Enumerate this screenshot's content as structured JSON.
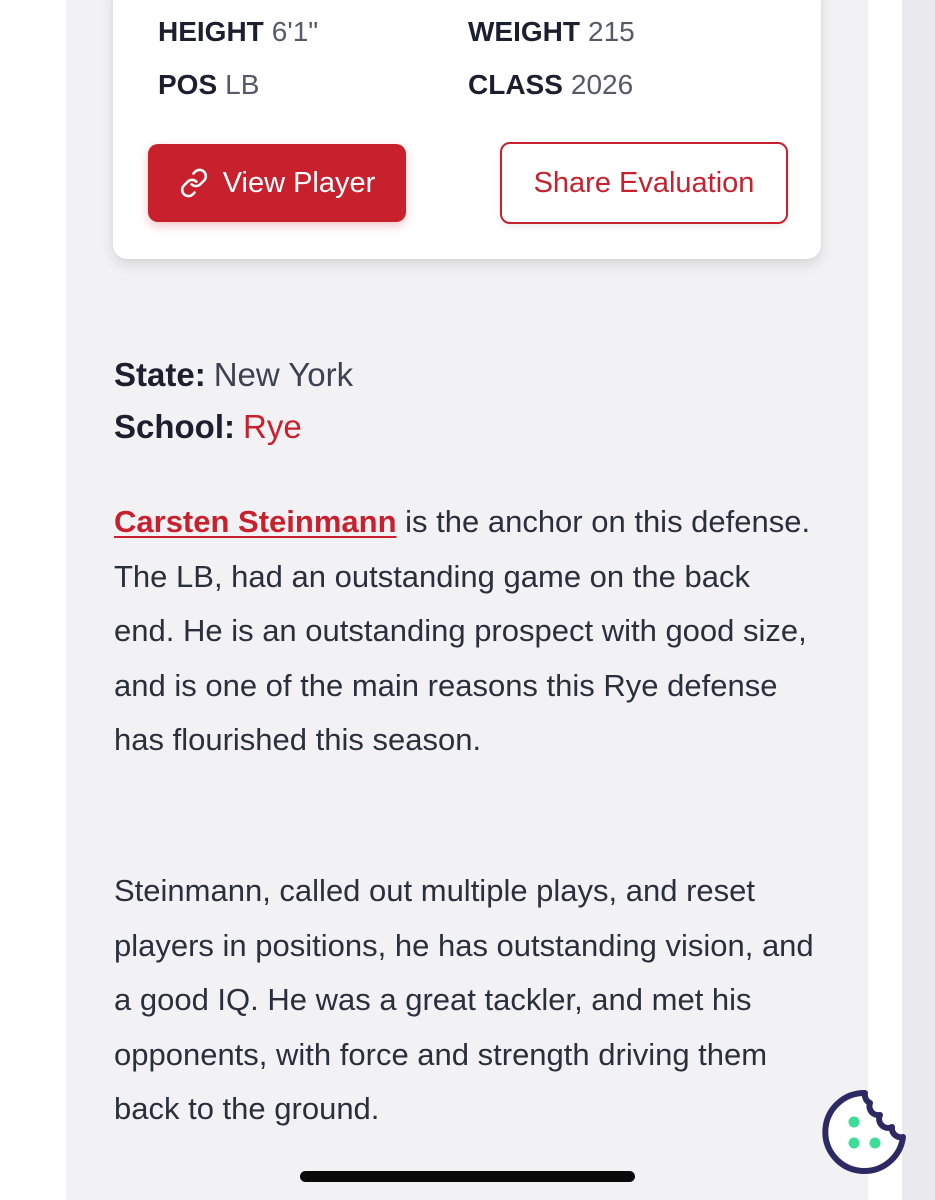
{
  "player_card": {
    "height_label": "HEIGHT",
    "height_value": "6'1\"",
    "weight_label": "WEIGHT",
    "weight_value": "215",
    "pos_label": "POS",
    "pos_value": "LB",
    "class_label": "CLASS",
    "class_value": "2026",
    "view_player_label": "View Player",
    "view_player_icon": "link-icon",
    "share_label": "Share Evaluation"
  },
  "meta": {
    "state_label": "State:",
    "state_value": "New York",
    "school_label": "School:",
    "school_value": "Rye"
  },
  "article": {
    "player_name": "Carsten Steinmann",
    "para1_rest": " is the anchor on this defense. The LB, had an outstanding game on the back end. He is an outstanding prospect with good size, and is one of the main reasons this Rye defense has flourished this season.",
    "para2": "Steinmann, called out multiple plays, and reset players in positions, he has outstanding vision, and a good IQ. He was a great tackler, and met his opponents, with force and strength driving them back to the ground."
  },
  "colors": {
    "accent": "#c8202c",
    "cookie": "#2d2a63",
    "cookie_dots": "#3ddc97"
  },
  "floating": {
    "cookie_icon": "cookie-icon"
  }
}
